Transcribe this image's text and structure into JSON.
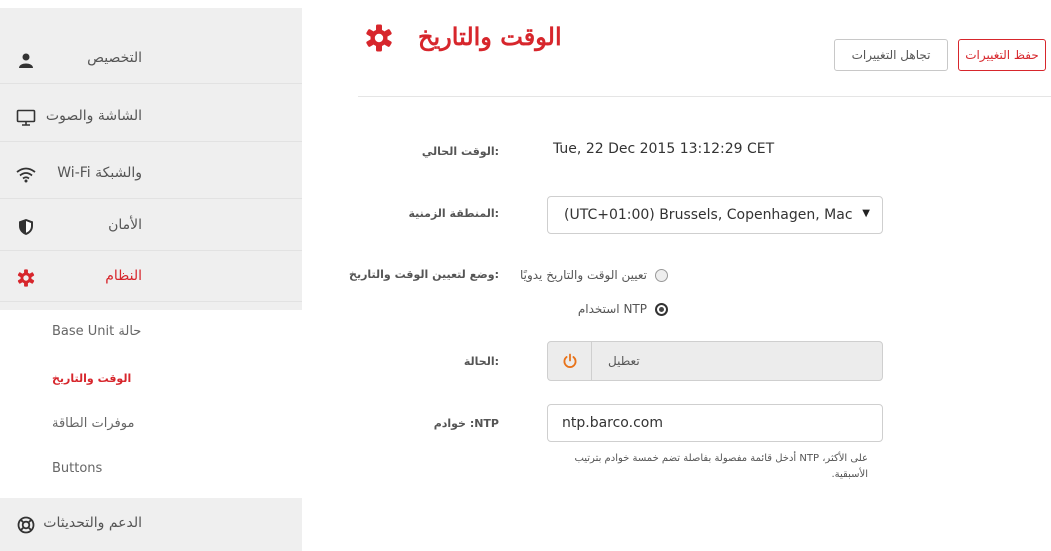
{
  "page": {
    "title": "الوقت والتاريخ",
    "accent_color": "#d7262c"
  },
  "toolbar": {
    "discard_label": "تجاهل التغييرات",
    "save_label": "حفظ التغييرات"
  },
  "sidebar": {
    "items": [
      {
        "label": "التخصيص",
        "icon": "user-icon"
      },
      {
        "label": "الشاشة والصوت",
        "icon": "monitor-icon"
      },
      {
        "label": "والشبكة Wi-Fi",
        "icon": "wifi-icon"
      },
      {
        "label": "الأمان",
        "icon": "shield-icon"
      },
      {
        "label": "النظام",
        "icon": "gear-icon",
        "active": true
      },
      {
        "label": "الدعم والتحديثات",
        "icon": "lifebuoy-icon"
      }
    ],
    "subitems": [
      {
        "label": "Base Unit حالة"
      },
      {
        "label": "الوقت والتاريخ",
        "active": true
      },
      {
        "label": "موفرات الطاقة"
      },
      {
        "label": "Buttons"
      }
    ]
  },
  "form": {
    "current_time": {
      "label": ":الوقت الحالي",
      "value": "Tue, 22 Dec 2015 13:12:29 CET"
    },
    "timezone": {
      "label": ":المنطقة الزمنية",
      "value": "(UTC+01:00) Brussels, Copenhagen, Mac"
    },
    "mode": {
      "label": ":وضع لتعيين الوقت والتاريخ",
      "options": [
        {
          "label": "تعيين الوقت والتاريخ يدويًا",
          "selected": false
        },
        {
          "label": "NTP استخدام",
          "selected": true
        }
      ]
    },
    "status": {
      "label": ":الحالة",
      "value": "تعطيل"
    },
    "ntp": {
      "label": "NTP: خوادم",
      "value": "ntp.barco.com",
      "help": "على الأكثر، NTP أدخل قائمة مفصولة بفاصلة تضم خمسة خوادم بترتيب الأسبقية."
    }
  }
}
